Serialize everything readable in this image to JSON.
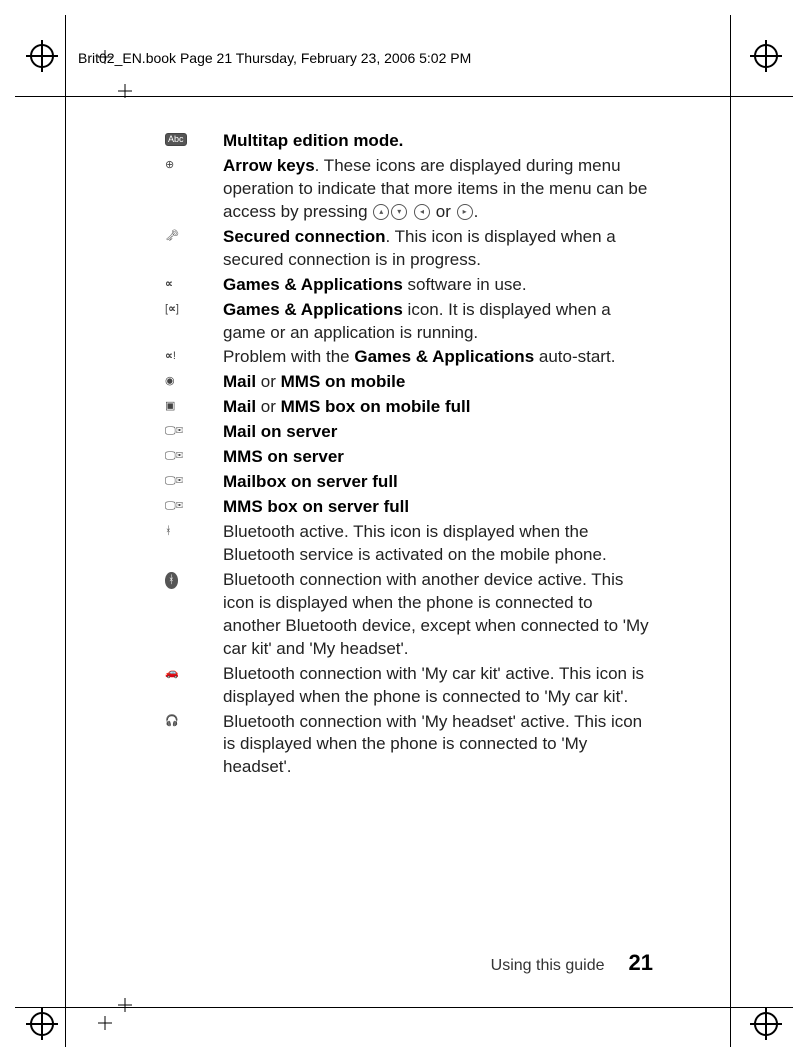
{
  "header": "Brit02_EN.book  Page 21  Thursday, February 23, 2006  5:02 PM",
  "footer": {
    "section": "Using this guide",
    "page": "21"
  },
  "inline_glyphs": {
    "up": "▴",
    "down": "▾",
    "left": "◂",
    "right": "▸",
    "or": " or "
  },
  "rows": [
    {
      "icon": "abc-icon",
      "parts": [
        {
          "b": true,
          "t": "Multitap edition mode."
        }
      ]
    },
    {
      "icon": "arrows-icon",
      "parts": [
        {
          "b": true,
          "t": "Arrow keys"
        },
        {
          "b": false,
          "t": ". These icons are displayed during menu operation to indicate that more items in the menu can be access by pressing "
        },
        {
          "glyph": "up"
        },
        {
          "glyph": "down"
        },
        {
          "b": false,
          "t": " "
        },
        {
          "glyph": "left"
        },
        {
          "b": false,
          "t": " or "
        },
        {
          "glyph": "right"
        },
        {
          "b": false,
          "t": "."
        }
      ]
    },
    {
      "icon": "key-icon",
      "parts": [
        {
          "b": true,
          "t": "Secured connection"
        },
        {
          "b": false,
          "t": ". This icon is displayed when a secured connection is in progress."
        }
      ]
    },
    {
      "icon": "games-icon",
      "parts": [
        {
          "b": true,
          "t": "Games & Applications"
        },
        {
          "b": false,
          "t": " software in use."
        }
      ]
    },
    {
      "icon": "games-bracket-icon",
      "parts": [
        {
          "b": true,
          "t": "Games & Applications"
        },
        {
          "b": false,
          "t": " icon. It is displayed when a game or an application is running."
        }
      ]
    },
    {
      "icon": "games-warn-icon",
      "parts": [
        {
          "b": false,
          "t": "Problem with the "
        },
        {
          "b": true,
          "t": "Games & Applications"
        },
        {
          "b": false,
          "t": " auto-start."
        }
      ]
    },
    {
      "icon": "mail-icon",
      "parts": [
        {
          "b": true,
          "t": "Mail"
        },
        {
          "b": false,
          "t": " or "
        },
        {
          "b": true,
          "t": "MMS on mobile"
        }
      ]
    },
    {
      "icon": "mail-full-icon",
      "parts": [
        {
          "b": true,
          "t": "Mail"
        },
        {
          "b": false,
          "t": " or "
        },
        {
          "b": true,
          "t": "MMS box on mobile full"
        }
      ]
    },
    {
      "icon": "mail-server-icon",
      "parts": [
        {
          "b": true,
          "t": "Mail on server"
        }
      ]
    },
    {
      "icon": "mms-server-icon",
      "parts": [
        {
          "b": true,
          "t": "MMS on server"
        }
      ]
    },
    {
      "icon": "mailbox-server-full-icon",
      "parts": [
        {
          "b": true,
          "t": "Mailbox on server full"
        }
      ]
    },
    {
      "icon": "mmsbox-server-full-icon",
      "parts": [
        {
          "b": true,
          "t": "MMS box on server full"
        }
      ]
    },
    {
      "icon": "bluetooth-icon",
      "parts": [
        {
          "b": false,
          "t": "Bluetooth active. This icon is displayed when the Bluetooth service is activated on the mobile phone."
        }
      ]
    },
    {
      "icon": "bluetooth-connected-icon",
      "parts": [
        {
          "b": false,
          "t": "Bluetooth connection with another device active. This icon is displayed when the phone is connected to another Bluetooth device, except when connected to 'My car kit' and 'My headset'."
        }
      ]
    },
    {
      "icon": "bluetooth-car-icon",
      "parts": [
        {
          "b": false,
          "t": "Bluetooth connection with 'My car kit' active. This icon is displayed when the phone is connected to 'My car kit'."
        }
      ]
    },
    {
      "icon": "bluetooth-headset-icon",
      "parts": [
        {
          "b": false,
          "t": "Bluetooth connection with 'My headset' active. This icon is displayed when the phone is connected to 'My headset'."
        }
      ]
    }
  ]
}
